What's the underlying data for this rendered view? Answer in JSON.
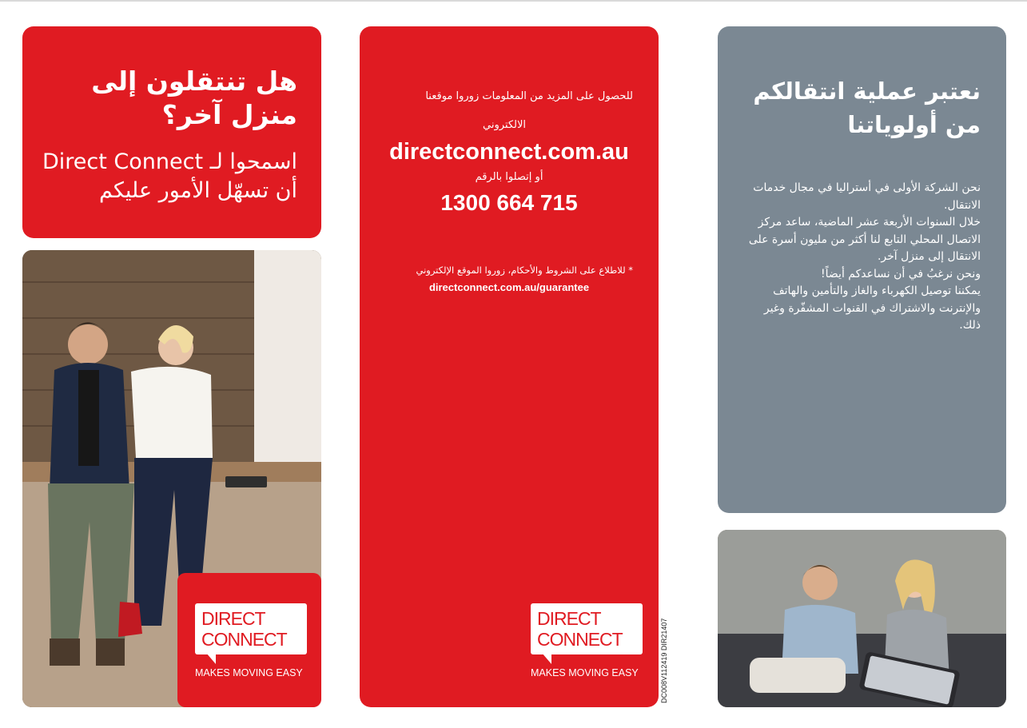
{
  "left_panel": {
    "heading": "هل تنتقلون إلى منزل آخر؟",
    "subheading": "اسمحوا لـ Direct Connect أن تسهّل الأمور عليكم"
  },
  "logo": {
    "line1": "DIRECT",
    "line2": "CONNECT",
    "tagline": "MAKES MOVING EASY"
  },
  "middle_panel": {
    "info_line1": "للحصول على المزيد من المعلومات زوروا موقعنا",
    "info_line2": "الالكتروني",
    "website": "directconnect.com.au",
    "or_call": "أو إتصلوا بالرقم",
    "phone": "1300 664 715",
    "terms_text": "* للاطلاع على الشروط والأحكام، زوروا الموقع الإلكتروني",
    "terms_url": "directconnect.com.au/guarantee"
  },
  "side_code": "DC008V112419  DIR21407",
  "right_panel": {
    "heading": "نعتبر عملية انتقالكم من أولوياتنا",
    "paragraphs": [
      "نحن الشركة الأولى في أستراليا في مجال خدمات الانتقال.",
      "خلال السنوات الأربعة عشر الماضية، ساعد مركز الاتصال المحلي التابع لنا أكثر من مليون أسرة على الانتقال إلى منزل آخر.",
      "ونحن نرغبُ في أن نساعدكم أيضاً!",
      "يمكننا توصيل الكهرباء والغاز والتأمين والهاتف والإنترنت والاشتراك في القنوات المشفّرة وغير ذلك."
    ]
  },
  "colors": {
    "brand_red": "#e01b22",
    "grey_panel": "#7b8893"
  }
}
